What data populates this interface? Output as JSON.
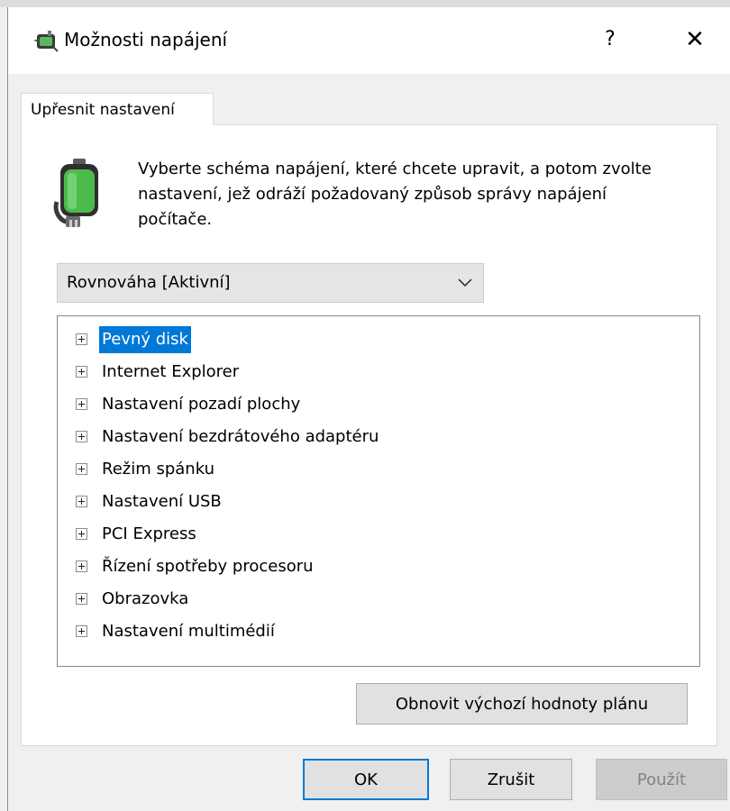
{
  "window": {
    "title": "Možnosti napájení",
    "help_label": "?",
    "close_label": "✕"
  },
  "tab": {
    "label": "Upřesnit nastavení"
  },
  "description": "Vyberte schéma napájení, které chcete upravit, a potom zvolte nastavení, jež odráží požadovaný způsob správy napájení počítače.",
  "plan_select": {
    "value": "Rovnováha [Aktivní]"
  },
  "tree": {
    "items": [
      {
        "label": "Pevný disk",
        "selected": true
      },
      {
        "label": "Internet Explorer"
      },
      {
        "label": "Nastavení pozadí plochy"
      },
      {
        "label": "Nastavení bezdrátového adaptéru"
      },
      {
        "label": "Režim spánku"
      },
      {
        "label": "Nastavení USB"
      },
      {
        "label": "PCI Express"
      },
      {
        "label": "Řízení spotřeby procesoru"
      },
      {
        "label": "Obrazovka"
      },
      {
        "label": "Nastavení multimédií"
      }
    ]
  },
  "buttons": {
    "restore": "Obnovit výchozí hodnoty plánu",
    "ok": "OK",
    "cancel": "Zrušit",
    "apply": "Použít"
  },
  "colors": {
    "selection": "#0078d7",
    "focus_border": "#0078d7",
    "disabled_text": "#838383"
  }
}
